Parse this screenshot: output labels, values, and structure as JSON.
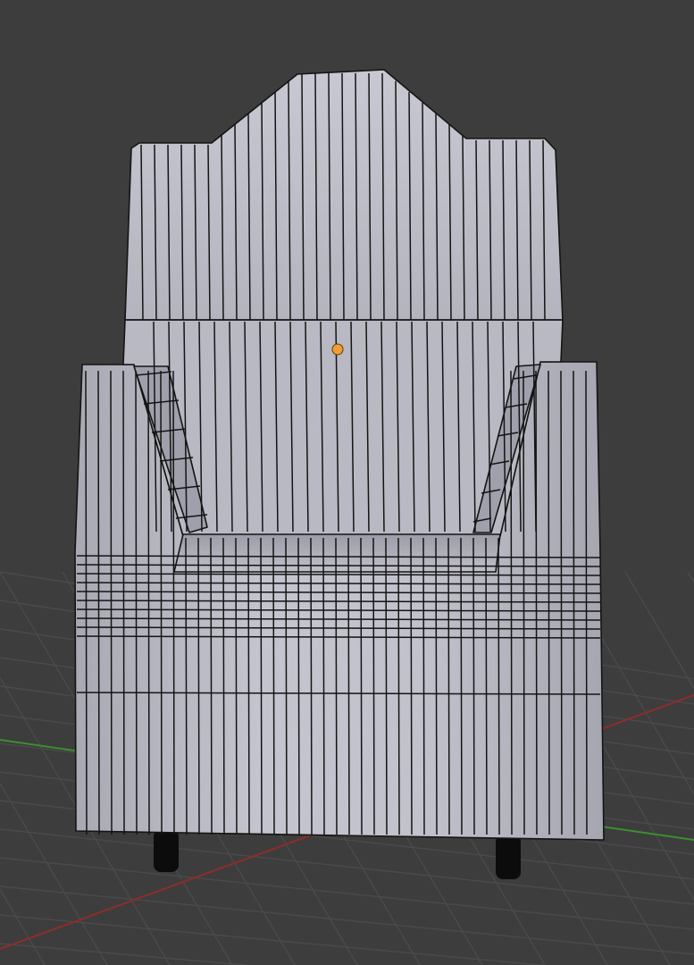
{
  "viewport": {
    "mode": "edit-mode-wireframe-overlay",
    "object": "armchair-mesh",
    "shading": "solid",
    "colors": {
      "background": "#3d3d3d",
      "grid": "#4a4a4a",
      "x_axis": "#8e2c2c",
      "y_axis": "#3c8f2f",
      "mesh_fill": "#bdbdc7",
      "mesh_shadow": "#9a9aa6",
      "mesh_edge": "#141414",
      "origin": "#f0a030",
      "legs": "#0c0c0c"
    },
    "icons": [
      "origin-point-icon"
    ]
  }
}
